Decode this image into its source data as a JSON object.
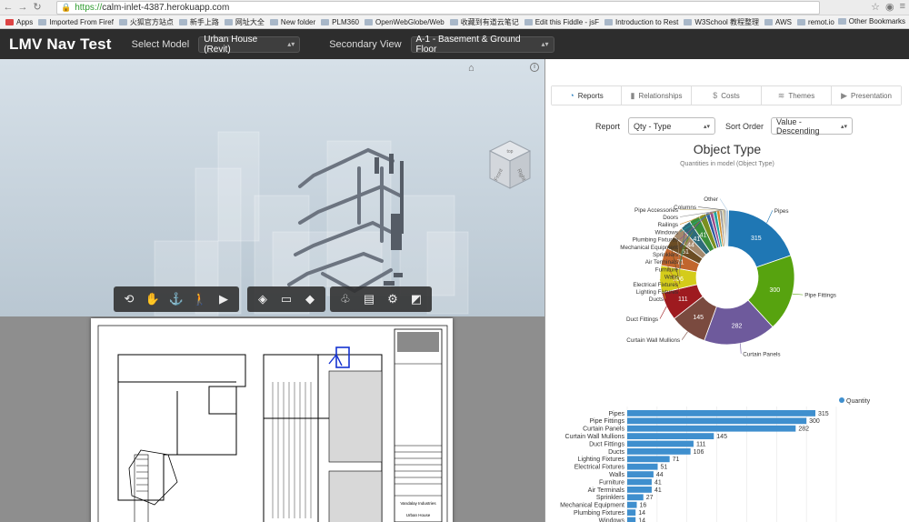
{
  "browser": {
    "url_https": "https://",
    "url_rest": "calm-inlet-4387.herokuapp.com",
    "bookmarks": [
      "Apps",
      "Imported From Firef",
      "火狐官方站点",
      "新手上路",
      "网址大全",
      "New folder",
      "PLM360",
      "OpenWebGlobe/Web",
      "收藏到有道云笔记",
      "Edit this Fiddle - jsF",
      "Introduction to Rest",
      "W3School 教程整理",
      "AWS",
      "remot.io"
    ],
    "other_bookmarks": "Other Bookmarks"
  },
  "header": {
    "title": "LMV Nav Test",
    "model_label": "Select Model",
    "model_value": "Urban House (Revit)",
    "view_label": "Secondary View",
    "view_value": "A-1 - Basement & Ground Floor"
  },
  "viewer": {
    "viewcube_faces": [
      "top",
      "Front",
      "Right"
    ],
    "toolbar_icons": [
      "orbit-icon",
      "pan-icon",
      "zoom-icon",
      "walk-icon",
      "camera-icon",
      "explode-icon",
      "section-icon",
      "cube-icon",
      "structure-icon",
      "properties-icon",
      "settings-icon",
      "fullscreen-icon"
    ]
  },
  "panel": {
    "tabs": [
      {
        "label": "Reports",
        "icon": "reports-icon"
      },
      {
        "label": "Relationships",
        "icon": "bar-chart-icon"
      },
      {
        "label": "Costs",
        "icon": "dollar-icon"
      },
      {
        "label": "Themes",
        "icon": "layers-icon"
      },
      {
        "label": "Presentation",
        "icon": "play-icon"
      }
    ],
    "report_label": "Report",
    "report_value": "Qty - Type",
    "sort_label": "Sort Order",
    "sort_value": "Value - Descending"
  },
  "chart_data": [
    {
      "type": "pie",
      "title": "Object Type",
      "subtitle": "Quantities in model (Object Type)",
      "donut": true,
      "categories": [
        "Pipes",
        "Pipe Fittings",
        "Curtain Panels",
        "Curtain Wall Mullions",
        "Duct Fittings",
        "Ducts",
        "Lighting Fixtures",
        "Electrical Fixtures",
        "Walls",
        "Furniture",
        "Air Terminals",
        "Sprinklers",
        "Mechanical Equipment",
        "Plumbing Fixtures",
        "Windows",
        "Railings",
        "Doors",
        "Pipe Accessories",
        "Columns",
        "Other"
      ],
      "values": [
        315,
        300,
        282,
        145,
        111,
        106,
        71,
        51,
        44,
        41,
        41,
        27,
        16,
        14,
        14,
        12,
        10,
        8,
        6,
        10
      ],
      "colors": [
        "#1f77b4",
        "#57a30f",
        "#6e5a9c",
        "#7a4a3f",
        "#9e1a1f",
        "#d4cc1a",
        "#c1662d",
        "#6b4d24",
        "#a5896c",
        "#2e6b7a",
        "#3b8e3b",
        "#7a8f1f",
        "#2c5aa0",
        "#9b4e8c",
        "#20a5a0",
        "#cf8c2a",
        "#8f8f8f",
        "#c1b27a",
        "#4d4d4d",
        "#a9c7e0"
      ],
      "show_value_labels": true
    },
    {
      "type": "bar",
      "orientation": "horizontal",
      "legend": "Quantity",
      "legend_position": "top-right",
      "categories": [
        "Pipes",
        "Pipe Fittings",
        "Curtain Panels",
        "Curtain Wall Mullions",
        "Duct Fittings",
        "Ducts",
        "Lighting Fixtures",
        "Electrical Fixtures",
        "Walls",
        "Furniture",
        "Air Terminals",
        "Sprinklers",
        "Mechanical Equipment",
        "Plumbing Fixtures",
        "Windows"
      ],
      "values": [
        315,
        300,
        282,
        145,
        111,
        106,
        71,
        51,
        44,
        41,
        41,
        27,
        16,
        14,
        14
      ],
      "color": "#3f8fce",
      "xlim": [
        0,
        350
      ]
    }
  ],
  "sheet": {
    "title_block_lines": [
      "Vandalay Industries",
      "Urban House"
    ]
  }
}
